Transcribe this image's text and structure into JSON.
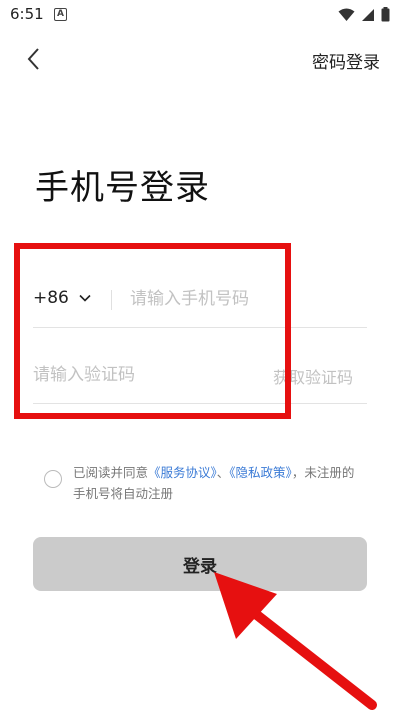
{
  "status_bar": {
    "time": "6:51",
    "notification_letter": "A",
    "icons": [
      "wifi-icon",
      "signal-icon",
      "battery-icon"
    ]
  },
  "nav": {
    "back_icon": "chevron-left-icon",
    "password_login_label": "密码登录"
  },
  "title": "手机号登录",
  "phone": {
    "country_code": "+86",
    "dropdown_icon": "chevron-down-icon",
    "placeholder": "请输入手机号码",
    "value": ""
  },
  "verification": {
    "placeholder": "请输入验证码",
    "value": "",
    "get_code_label": "获取验证码"
  },
  "agreement": {
    "checked": false,
    "prefix": "已阅读并同意",
    "service_link": "《服务协议》",
    "separator": "、",
    "privacy_link": "《隐私政策》",
    "suffix": "，未注册的手机号将自动注册"
  },
  "login_button_label": "登录",
  "colors": {
    "link": "#3b7bd6",
    "button_bg": "#cbcbcb",
    "placeholder": "#c2c2c2",
    "annotation": "#e61010"
  }
}
